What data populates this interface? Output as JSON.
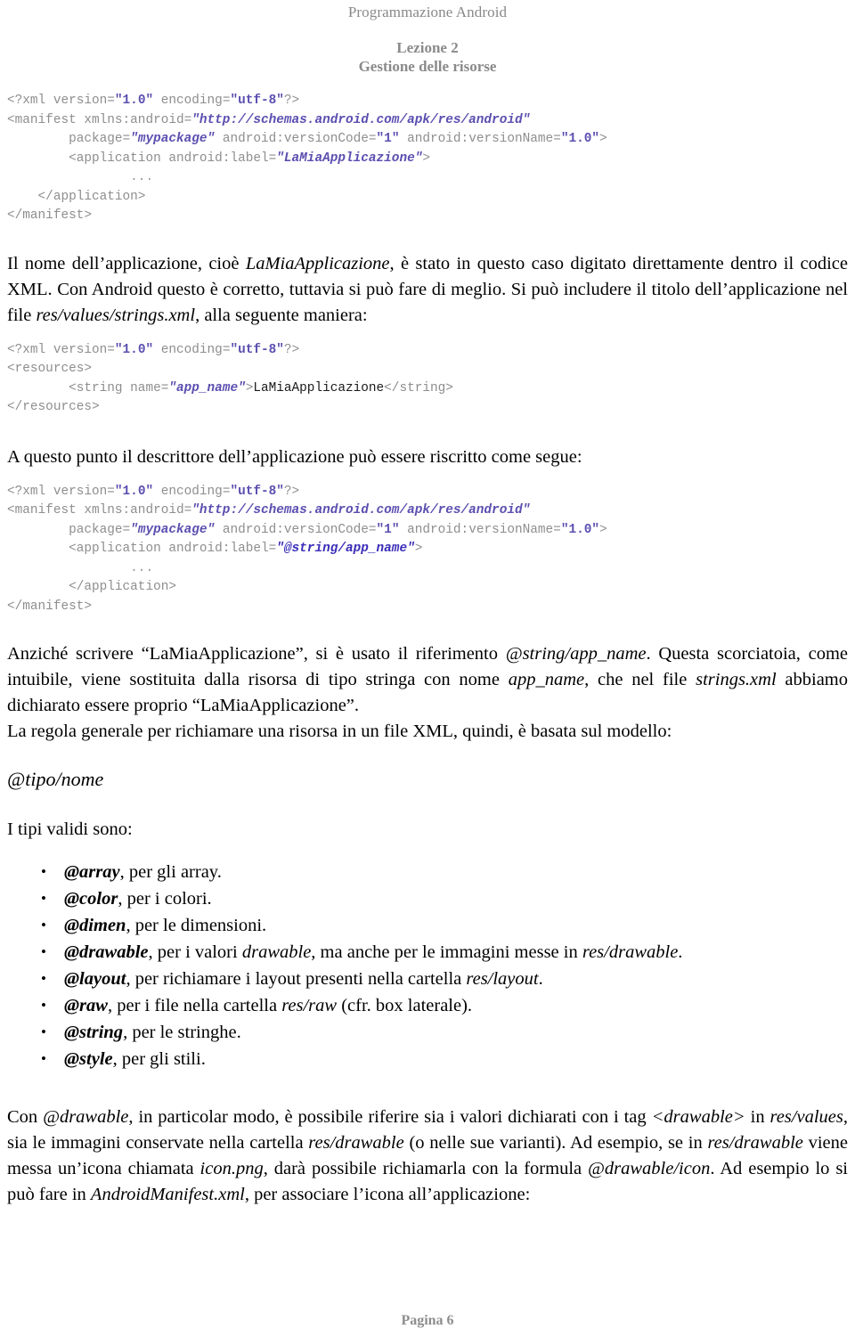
{
  "header": {
    "running_head": "Programmazione Android",
    "lesson_title": "Lezione 2",
    "lesson_subtitle": "Gestione delle risorse"
  },
  "code_block_1": {
    "line1_a": "<?xml version=",
    "line1_b": "\"1.0\"",
    "line1_c": " encoding=",
    "line1_d": "\"utf-8\"",
    "line1_e": "?>",
    "line2_a": "<manifest xmlns:android=",
    "line2_b": "\"http://schemas.android.com/apk/res/android\"",
    "line3_a": "        package=",
    "line3_b": "\"mypackage\"",
    "line3_c": " android:versionCode=",
    "line3_d": "\"1\"",
    "line3_e": " android:versionName=",
    "line3_f": "\"1.0\"",
    "line3_g": ">",
    "line4_a": "        <application android:label=",
    "line4_b": "\"LaMiaApplicazione\"",
    "line4_c": ">",
    "line5": "                ...",
    "line6": "    </application>",
    "line7": "</manifest>"
  },
  "paragraph_1": {
    "t1": "Il nome dell’applicazione, cioè ",
    "i1": "LaMiaApplicazione",
    "t2": ", è stato in questo caso digitato direttamente dentro il codice XML. Con Android questo è corretto, tuttavia si può fare di meglio. Si può includere il titolo dell’applicazione nel file ",
    "i2": "res/values/strings.xml",
    "t3": ", alla seguente maniera:"
  },
  "code_block_2": {
    "line1_a": "<?xml version=",
    "line1_b": "\"1.0\"",
    "line1_c": " encoding=",
    "line1_d": "\"utf-8\"",
    "line1_e": "?>",
    "line2": "<resources>",
    "line3_a": "        <string name=",
    "line3_b": "\"app_name\"",
    "line3_c": ">",
    "line3_d": "LaMiaApplicazione",
    "line3_e": "</string>",
    "line4": "</resources>"
  },
  "paragraph_2": {
    "t1": "A questo punto il descrittore dell’applicazione può essere riscritto come segue:"
  },
  "code_block_3": {
    "line1_a": "<?xml version=",
    "line1_b": "\"1.0\"",
    "line1_c": " encoding=",
    "line1_d": "\"utf-8\"",
    "line1_e": "?>",
    "line2_a": "<manifest xmlns:android=",
    "line2_b": "\"http://schemas.android.com/apk/res/android\"",
    "line3_a": "        package=",
    "line3_b": "\"mypackage\"",
    "line3_c": " android:versionCode=",
    "line3_d": "\"1\"",
    "line3_e": " android:versionName=",
    "line3_f": "\"1.0\"",
    "line3_g": ">",
    "line4_a": "        <application android:label=",
    "line4_b": "\"@string/app_name\"",
    "line4_c": ">",
    "line5": "                ...",
    "line6": "        </application>",
    "line7": "</manifest>"
  },
  "paragraph_3": {
    "t1": "Anziché scrivere “LaMiaApplicazione”, si è usato il riferimento ",
    "i1": "@string/app_name",
    "t2": ". Questa scorciatoia, come intuibile, viene sostituita dalla risorsa di tipo stringa con nome ",
    "i2": "app_name",
    "t3": ", che nel file ",
    "i3": "strings.xml",
    "t4": " abbiamo dichiarato essere proprio “LaMiaApplicazione”."
  },
  "paragraph_4": {
    "t1": "La regola generale per richiamare una risorsa in un file XML, quindi, è basata sul modello:"
  },
  "formula": "@tipo/nome",
  "paragraph_5": {
    "t1": "I tipi validi sono:"
  },
  "bullets": [
    {
      "marker": "•",
      "token": "@array",
      "rest_1": ", per gli array.",
      "em": "",
      "rest_2": ""
    },
    {
      "marker": "•",
      "token": "@color",
      "rest_1": ", per i colori.",
      "em": "",
      "rest_2": ""
    },
    {
      "marker": "•",
      "token": "@dimen",
      "rest_1": ", per le dimensioni.",
      "em": "",
      "rest_2": ""
    },
    {
      "marker": "•",
      "token": "@drawable",
      "rest_1": ", per i valori ",
      "em": "drawable",
      "rest_2": ", ma anche per le immagini messe in ",
      "em2": "res/drawable",
      "rest_3": "."
    },
    {
      "marker": "•",
      "token": "@layout",
      "rest_1": ", per richiamare i layout presenti nella cartella ",
      "em": "res/layout",
      "rest_2": "."
    },
    {
      "marker": "•",
      "token": "@raw",
      "rest_1": ", per i file nella cartella ",
      "em": "res/raw",
      "rest_2": " (cfr. box laterale)."
    },
    {
      "marker": "•",
      "token": "@string",
      "rest_1": ", per le stringhe.",
      "em": "",
      "rest_2": ""
    },
    {
      "marker": "•",
      "token": "@style",
      "rest_1": ", per gli stili.",
      "em": "",
      "rest_2": ""
    }
  ],
  "paragraph_6": {
    "t1": "Con ",
    "i1": "@drawable",
    "t2": ", in particolar modo, è possibile riferire sia i valori dichiarati con i tag ",
    "i2": "<drawable>",
    "t3": " in ",
    "i3": "res/values",
    "t4": ", sia le immagini conservate nella cartella ",
    "i4": "res/drawable",
    "t5": " (o nelle sue varianti). Ad esempio, se in ",
    "i5": "res/drawable",
    "t6": " viene messa un’icona chiamata ",
    "i6": "icon.png",
    "t7": ", darà possibile richiamarla con la formula ",
    "i7": "@drawable/icon",
    "t8": ". Ad esempio lo si può fare in ",
    "i8": "AndroidManifest.xml",
    "t9": ", per associare l’icona all’applicazione:"
  },
  "footer": {
    "page_label": "Pagina 6"
  },
  "colors": {
    "header_gray": "#8a8a8a",
    "code_tag_gray": "#8e8e8e",
    "code_value_purple": "#5b4fb0",
    "code_ref_blue": "#3b2fb8",
    "body_black": "#000000",
    "footer_gray": "#8d8d8d",
    "page_background": "#ffffff"
  }
}
